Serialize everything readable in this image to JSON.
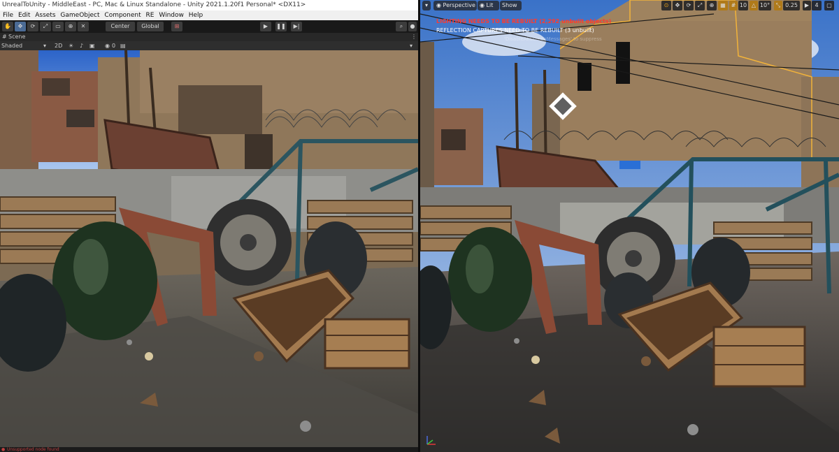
{
  "unity": {
    "window_title": "UnrealToUnity - MiddleEast - PC, Mac & Linux Standalone - Unity 2021.1.20f1 Personal* <DX11>",
    "menu": [
      "File",
      "Edit",
      "Assets",
      "GameObject",
      "Component",
      "RE",
      "Window",
      "Help"
    ],
    "toolbar": {
      "center_label": "Center",
      "global_label": "Global"
    },
    "scene_tab": "Scene",
    "scene_bar": {
      "shading_mode": "Shaded",
      "mode_2d": "2D",
      "gizmo_count": "0"
    },
    "status_text": "Unsupported node found"
  },
  "unreal": {
    "toolbar": {
      "perspective_label": "Perspective",
      "lit_label": "Lit",
      "show_label": "Show",
      "grid_snap": "10",
      "rotation_snap": "10°",
      "scale_snap": "0.25",
      "camera_speed": "4"
    },
    "warnings": {
      "lighting": "LIGHTING NEEDS TO BE REBUILT (2,292 unbuilt objects)",
      "reflection": "REFLECTION CAPTURES NEED TO BE REBUILT (3 unbuilt)",
      "suppress_hint": "'DisableAllScreenMessages' to suppress"
    }
  },
  "colors": {
    "unity_accent": "#3a79bb",
    "unreal_warning": "#ff3a2e",
    "unreal_snap_active": "#e8a21c"
  }
}
